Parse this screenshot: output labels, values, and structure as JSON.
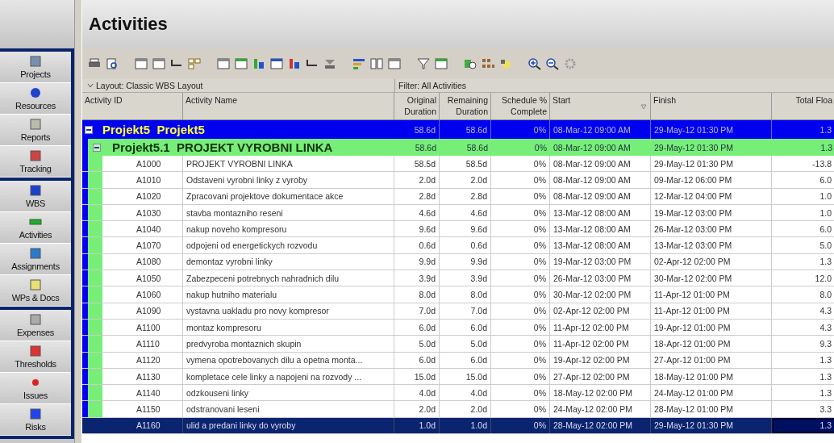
{
  "title": "Activities",
  "sidebar": {
    "groups": [
      {
        "items": [
          {
            "label": "Projects"
          },
          {
            "label": "Resources"
          },
          {
            "label": "Reports"
          },
          {
            "label": "Tracking"
          }
        ]
      },
      {
        "items": [
          {
            "label": "WBS"
          },
          {
            "label": "Activities"
          },
          {
            "label": "Assignments"
          },
          {
            "label": "WPs & Docs"
          }
        ]
      },
      {
        "items": [
          {
            "label": "Expenses"
          },
          {
            "label": "Thresholds"
          },
          {
            "label": "Issues"
          },
          {
            "label": "Risks"
          }
        ]
      }
    ]
  },
  "layout_bar": {
    "layout": "Layout: Classic WBS Layout",
    "filter": "Filter: All Activities"
  },
  "table": {
    "columns": [
      {
        "label": "Activity ID"
      },
      {
        "label": "Activity Name"
      },
      {
        "label": "Original Duration"
      },
      {
        "label": "Remaining Duration"
      },
      {
        "label": "Schedule % Complete"
      },
      {
        "label": "Start",
        "sorted": true
      },
      {
        "label": "Finish"
      },
      {
        "label": "Total Floa"
      }
    ],
    "rows": [
      {
        "kind": "project",
        "expanded": true,
        "cells": [
          "Projekt5",
          "Projekt5",
          "58.6d",
          "58.6d",
          "0%",
          "08-Mar-12 09:00 AM",
          "29-May-12 01:30 PM",
          "1.3"
        ],
        "children": [
          {
            "kind": "wbs",
            "expanded": true,
            "cells": [
              "Projekt5.1",
              "PROJEKT VYROBNI LINKA",
              "58.6d",
              "58.6d",
              "0%",
              "08-Mar-12 09:00 AM",
              "29-May-12 01:30 PM",
              "1.3"
            ],
            "children": [
              {
                "kind": "activity",
                "selected": false,
                "cells": [
                  "A1000",
                  "PROJEKT VYROBNI LINKA",
                  "58.5d",
                  "58.5d",
                  "0%",
                  "08-Mar-12 09:00 AM",
                  "29-May-12 01:30 PM",
                  "-13.8"
                ]
              },
              {
                "kind": "activity",
                "selected": false,
                "cells": [
                  "A1010",
                  "Odstaveni vyrobni linky z vyroby",
                  "2.0d",
                  "2.0d",
                  "0%",
                  "08-Mar-12 09:00 AM",
                  "09-Mar-12 06:00 PM",
                  "6.0"
                ]
              },
              {
                "kind": "activity",
                "selected": false,
                "cells": [
                  "A1020",
                  "Zpracovani projektove dokumentace akce",
                  "2.8d",
                  "2.8d",
                  "0%",
                  "08-Mar-12 09:00 AM",
                  "12-Mar-12 04:00 PM",
                  "1.0"
                ]
              },
              {
                "kind": "activity",
                "selected": false,
                "cells": [
                  "A1030",
                  "stavba montazniho reseni",
                  "4.6d",
                  "4.6d",
                  "0%",
                  "13-Mar-12 08:00 AM",
                  "19-Mar-12 03:00 PM",
                  "1.0"
                ]
              },
              {
                "kind": "activity",
                "selected": false,
                "cells": [
                  "A1040",
                  "nakup noveho kompresoru",
                  "9.6d",
                  "9.6d",
                  "0%",
                  "13-Mar-12 08:00 AM",
                  "26-Mar-12 03:00 PM",
                  "6.0"
                ]
              },
              {
                "kind": "activity",
                "selected": false,
                "cells": [
                  "A1070",
                  "odpojeni od energetickych rozvodu",
                  "0.6d",
                  "0.6d",
                  "0%",
                  "13-Mar-12 08:00 AM",
                  "13-Mar-12 03:00 PM",
                  "5.0"
                ]
              },
              {
                "kind": "activity",
                "selected": false,
                "cells": [
                  "A1080",
                  "demontaz vyrobni linky",
                  "9.9d",
                  "9.9d",
                  "0%",
                  "19-Mar-12 03:00 PM",
                  "02-Apr-12 02:00 PM",
                  "1.3"
                ]
              },
              {
                "kind": "activity",
                "selected": false,
                "cells": [
                  "A1050",
                  "Zabezpeceni potrebnych nahradnich dilu",
                  "3.9d",
                  "3.9d",
                  "0%",
                  "26-Mar-12 03:00 PM",
                  "30-Mar-12 02:00 PM",
                  "12.0"
                ]
              },
              {
                "kind": "activity",
                "selected": false,
                "cells": [
                  "A1060",
                  "nakup hutniho materialu",
                  "8.0d",
                  "8.0d",
                  "0%",
                  "30-Mar-12 02:00 PM",
                  "11-Apr-12 01:00 PM",
                  "8.0"
                ]
              },
              {
                "kind": "activity",
                "selected": false,
                "cells": [
                  "A1090",
                  "vystavna uakladu pro novy kompresor",
                  "7.0d",
                  "7.0d",
                  "0%",
                  "02-Apr-12 02:00 PM",
                  "11-Apr-12 01:00 PM",
                  "4.3"
                ]
              },
              {
                "kind": "activity",
                "selected": false,
                "cells": [
                  "A1100",
                  "montaz kompresoru",
                  "6.0d",
                  "6.0d",
                  "0%",
                  "11-Apr-12 02:00 PM",
                  "19-Apr-12 01:00 PM",
                  "4.3"
                ]
              },
              {
                "kind": "activity",
                "selected": false,
                "cells": [
                  "A1110",
                  "predvyroba montaznich skupin",
                  "5.0d",
                  "5.0d",
                  "0%",
                  "11-Apr-12 02:00 PM",
                  "18-Apr-12 01:00 PM",
                  "9.3"
                ]
              },
              {
                "kind": "activity",
                "selected": false,
                "cells": [
                  "A1120",
                  "vymena opotrebovanych dilu a opetna monta...",
                  "6.0d",
                  "6.0d",
                  "0%",
                  "19-Apr-12 02:00 PM",
                  "27-Apr-12 01:00 PM",
                  "1.3"
                ]
              },
              {
                "kind": "activity",
                "selected": false,
                "cells": [
                  "A1130",
                  "kompletace cele linky a napojeni na rozvody ...",
                  "15.0d",
                  "15.0d",
                  "0%",
                  "27-Apr-12 02:00 PM",
                  "18-May-12 01:00 PM",
                  "1.3"
                ]
              },
              {
                "kind": "activity",
                "selected": false,
                "cells": [
                  "A1140",
                  "odzkouseni linky",
                  "4.0d",
                  "4.0d",
                  "0%",
                  "18-May-12 02:00 PM",
                  "24-May-12 01:00 PM",
                  "1.3"
                ]
              },
              {
                "kind": "activity",
                "selected": false,
                "cells": [
                  "A1150",
                  "odstranovani leseni",
                  "2.0d",
                  "2.0d",
                  "0%",
                  "24-May-12 02:00 PM",
                  "28-May-12 01:00 PM",
                  "3.3"
                ]
              },
              {
                "kind": "activity",
                "selected": true,
                "cells": [
                  "A1160",
                  "ulid a predani linky do vyroby",
                  "1.0d",
                  "1.0d",
                  "0%",
                  "28-May-12 02:00 PM",
                  "29-May-12 01:30 PM",
                  "1.3"
                ]
              }
            ]
          }
        ]
      }
    ]
  }
}
